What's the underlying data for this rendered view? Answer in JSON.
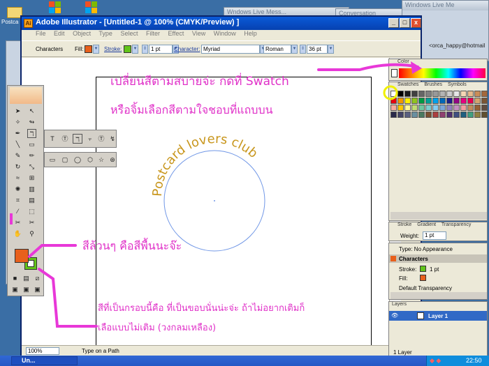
{
  "desktop": {
    "icon_label": "Postca",
    "right_text": "<orca_happy@hotmail",
    "bg_window_titles": [
      "Wndows Live Mess...",
      "Conversation",
      "Windows Live Me"
    ]
  },
  "window": {
    "title": "Adobe Illustrator - [Untitled-1 @ 100% (CMYK/Preview) ]",
    "logo": "Ai",
    "buttons": {
      "minimize": "_",
      "maximize": "□",
      "close": "x"
    },
    "menu": [
      "File",
      "Edit",
      "Object",
      "Type",
      "Select",
      "Filter",
      "Effect",
      "View",
      "Window",
      "Help"
    ]
  },
  "control_bar": {
    "mode_label": "Characters",
    "fill_label": "Fill:",
    "stroke_label": "Stroke:",
    "stroke_weight": "1 pt",
    "character_label": "Character:",
    "font": "Myriad",
    "style": "Roman",
    "size": "36 pt"
  },
  "artwork": {
    "curved_text": "Postcard lovers club"
  },
  "annotations": {
    "top_line1": "เปลี่ยนสีตามสบายจ่ะ  กดที่  Swatch",
    "top_line2": "หรือจิ้มเลือกสีตามใจชอบที่แถบบน",
    "mid": "สีล้วนๆ  คือสีพื้นนะจ๊ะ",
    "bottom_line1": "สีที่เป็นกรอบนี้คือ  ที่เป็นขอบนั่นน่ะจ่ะ  ถ้าไม่อยากเติมก็",
    "bottom_line2": "เลือแบบไม่เติม (วงกลมเหลือง)"
  },
  "panels": {
    "color_tab": "Color",
    "swatches_tabs": [
      "Swatches",
      "Brushes",
      "Symbols"
    ],
    "stroke_tabs": [
      "Stroke",
      "Gradient",
      "Transparency"
    ],
    "weight_label": "Weight:",
    "weight_value": "1 pt",
    "appearance": {
      "type": "Type: No Appearance",
      "characters": "Characters",
      "stroke": "Stroke:",
      "stroke_value": "1 pt",
      "fill": "Fill:",
      "transparency": "Default Transparency"
    },
    "layers_tab": "Layers",
    "layer_name": "Layer 1",
    "layer_count": "1 Layer"
  },
  "status": {
    "zoom": "100%",
    "info": "Type on a Path"
  },
  "taskbar": {
    "task": "Un...",
    "clock": "22:50"
  },
  "colors": {
    "annotation": "#e030c8",
    "arrow": "#e838d8",
    "circle_stroke": "#6f96e6",
    "curved_text": "#c8961c",
    "fill_swatch": "#e8601c",
    "stroke_swatch": "#62c41a",
    "highlight": "#f0f000"
  },
  "swatch_colors": [
    "#ffffff",
    "#000000",
    "#1a1a1a",
    "#404040",
    "#666666",
    "#808080",
    "#999999",
    "#b3b3b3",
    "#cccccc",
    "#e6e6e6",
    "#f4d6b4",
    "#e6b98c",
    "#c98d59",
    "#a4683c",
    "#e60012",
    "#f39800",
    "#fff100",
    "#8fc31f",
    "#009944",
    "#009e96",
    "#00a0e9",
    "#0068b7",
    "#1d2088",
    "#920783",
    "#e4007f",
    "#e5004f",
    "#d2a46f",
    "#7b5534",
    "#f7aa9c",
    "#fcc800",
    "#fff799",
    "#c2dc74",
    "#6ec7a0",
    "#7fcdd0",
    "#87cdf0",
    "#7da7d9",
    "#8f82bc",
    "#c490bf",
    "#f29c9f",
    "#c08c5c",
    "#956134",
    "#604c3f",
    "#2a2a4a",
    "#444466",
    "#5a6080",
    "#6a90a0",
    "#4a7a60",
    "#7a5030",
    "#aa4040",
    "#904070",
    "#503070",
    "#405080",
    "#206080",
    "#40a080",
    "#908040",
    "#605030"
  ]
}
